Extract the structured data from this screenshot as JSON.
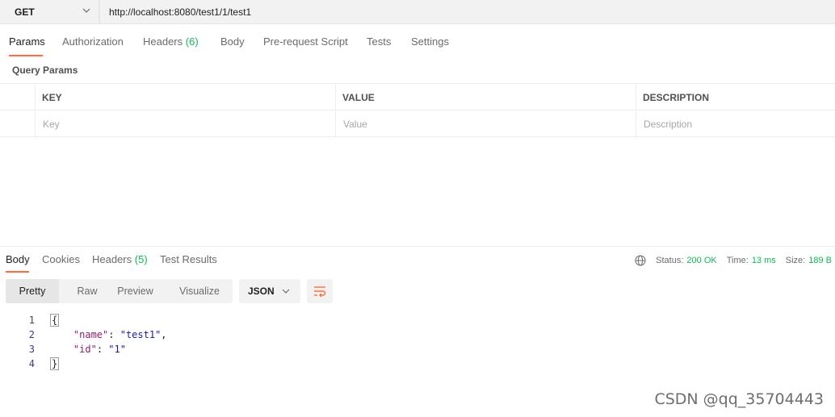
{
  "request": {
    "method": "GET",
    "url": "http://localhost:8080/test1/1/test1"
  },
  "request_tabs": [
    {
      "label": "Params",
      "count": "",
      "active": true
    },
    {
      "label": "Authorization",
      "count": ""
    },
    {
      "label": "Headers",
      "count": "(6)"
    },
    {
      "label": "Body",
      "count": ""
    },
    {
      "label": "Pre-request Script",
      "count": ""
    },
    {
      "label": "Tests",
      "count": ""
    },
    {
      "label": "Settings",
      "count": ""
    }
  ],
  "query_params": {
    "title": "Query Params",
    "columns": [
      "KEY",
      "VALUE",
      "DESCRIPTION"
    ],
    "placeholders": [
      "Key",
      "Value",
      "Description"
    ]
  },
  "response_tabs": [
    {
      "label": "Body",
      "count": "",
      "active": true
    },
    {
      "label": "Cookies",
      "count": ""
    },
    {
      "label": "Headers",
      "count": "(5)"
    },
    {
      "label": "Test Results",
      "count": ""
    }
  ],
  "status": {
    "status_label": "Status:",
    "status_value": "200 OK",
    "time_label": "Time:",
    "time_value": "13 ms",
    "size_label": "Size:",
    "size_value": "189 B"
  },
  "view_modes": [
    "Pretty",
    "Raw",
    "Preview",
    "Visualize"
  ],
  "format": "JSON",
  "code_lines": [
    {
      "num": "1",
      "text": "{"
    },
    {
      "num": "2",
      "key": "\"name\"",
      "sep": ": ",
      "value": "\"test1\"",
      "end": ","
    },
    {
      "num": "3",
      "key": "\"id\"",
      "sep": ": ",
      "value": "\"1\"",
      "end": ""
    },
    {
      "num": "4",
      "text": "}"
    }
  ],
  "watermark": "CSDN @qq_35704443",
  "colors": {
    "accent": "#ff6c37",
    "success": "#0cbb52"
  }
}
